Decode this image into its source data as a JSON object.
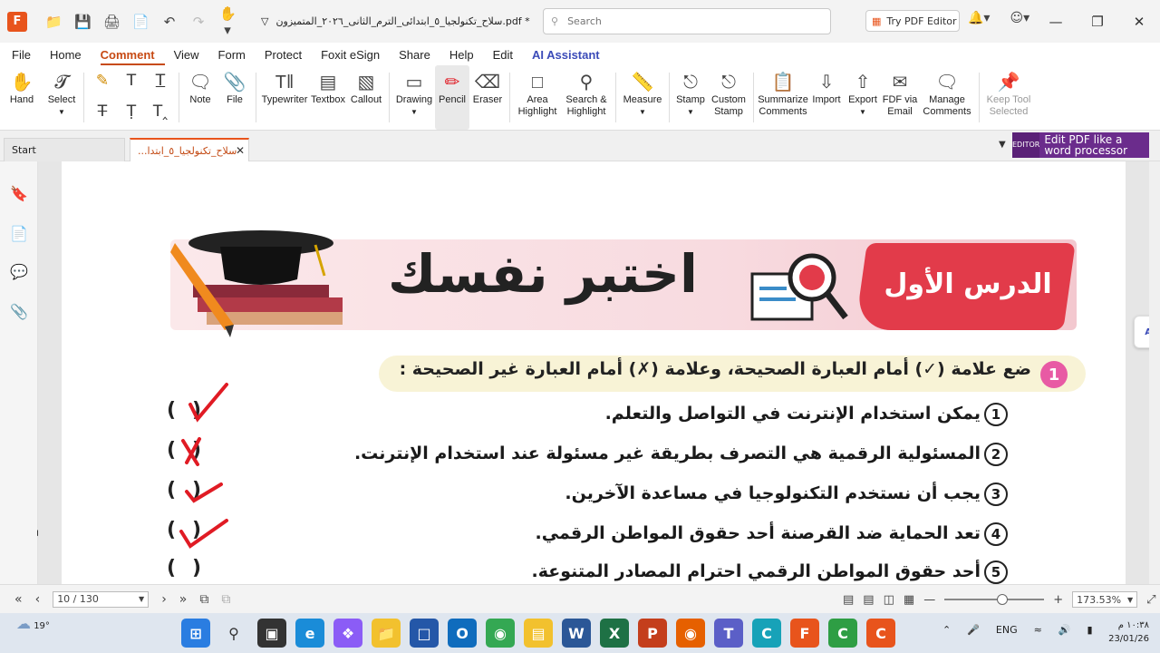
{
  "titlebar": {
    "file_title": "سلاح_تكنولجيا_٥_ابتدائى_الترم_الثانى_٢٠٢٦_المتميزون.pdf *",
    "search_placeholder": "Search",
    "try_pdf_editor": "Try PDF Editor"
  },
  "menu": [
    "File",
    "Home",
    "Comment",
    "View",
    "Form",
    "Protect",
    "Foxit eSign",
    "Share",
    "Help",
    "Edit",
    "AI Assistant"
  ],
  "menu_active": "Comment",
  "ribbon": {
    "hand": "Hand",
    "select": "Select",
    "note": "Note",
    "file": "File",
    "typewriter": "Typewriter",
    "textbox": "Textbox",
    "callout": "Callout",
    "drawing": "Drawing",
    "pencil": "Pencil",
    "eraser": "Eraser",
    "area_highlight_1": "Area",
    "area_highlight_2": "Highlight",
    "search_highlight_1": "Search &",
    "search_highlight_2": "Highlight",
    "measure": "Measure",
    "stamp": "Stamp",
    "custom_stamp_1": "Custom",
    "custom_stamp_2": "Stamp",
    "summarize_1": "Summarize",
    "summarize_2": "Comments",
    "import": "Import",
    "export": "Export",
    "fdf_1": "FDF via",
    "fdf_2": "Email",
    "manage_1": "Manage",
    "manage_2": "Comments",
    "keep_1": "Keep Tool",
    "keep_2": "Selected"
  },
  "tabs": {
    "start": "Start",
    "doc": "سلاح_تكنولجيا_٥_ابتدا..."
  },
  "promo": {
    "logo": "EDITOR",
    "text": "Edit PDF like a word processor"
  },
  "ai_float": "AI",
  "doc": {
    "banner_title": "اختبر نفسك",
    "lesson": "الدرس الأول",
    "question_number": "1",
    "instruction": "ضع علامة (✓) أمام العبارة الصحيحة، وعلامة (✗) أمام العبارة غير الصحيحة :",
    "statements": [
      {
        "n": "1",
        "text": "يمكن استخدام الإنترنت في التواصل والتعلم."
      },
      {
        "n": "2",
        "text": "المسئولية الرقمية هي التصرف بطريقة غير مسئولة عند استخدام الإنترنت."
      },
      {
        "n": "3",
        "text": "يجب أن نستخدم التكنولوجيا في مساعدة الآخرين."
      },
      {
        "n": "4",
        "text": "تعد الحماية ضد القرصنة أحد حقوق المواطن الرقمي."
      },
      {
        "n": "5",
        "text": "أحد حقوق المواطن الرقمي احترام المصادر المتنوعة."
      }
    ],
    "answer_marks": [
      "check",
      "cross",
      "check",
      "check",
      ""
    ],
    "mark_color": "#e01b24"
  },
  "status": {
    "page": "10 / 130",
    "zoom": "173.53%",
    "zoom_fraction": 0.58
  },
  "taskbar": {
    "temp": "19°",
    "lang": "ENG",
    "time": "١٠:٣٨ م",
    "date": "23/01/26"
  }
}
